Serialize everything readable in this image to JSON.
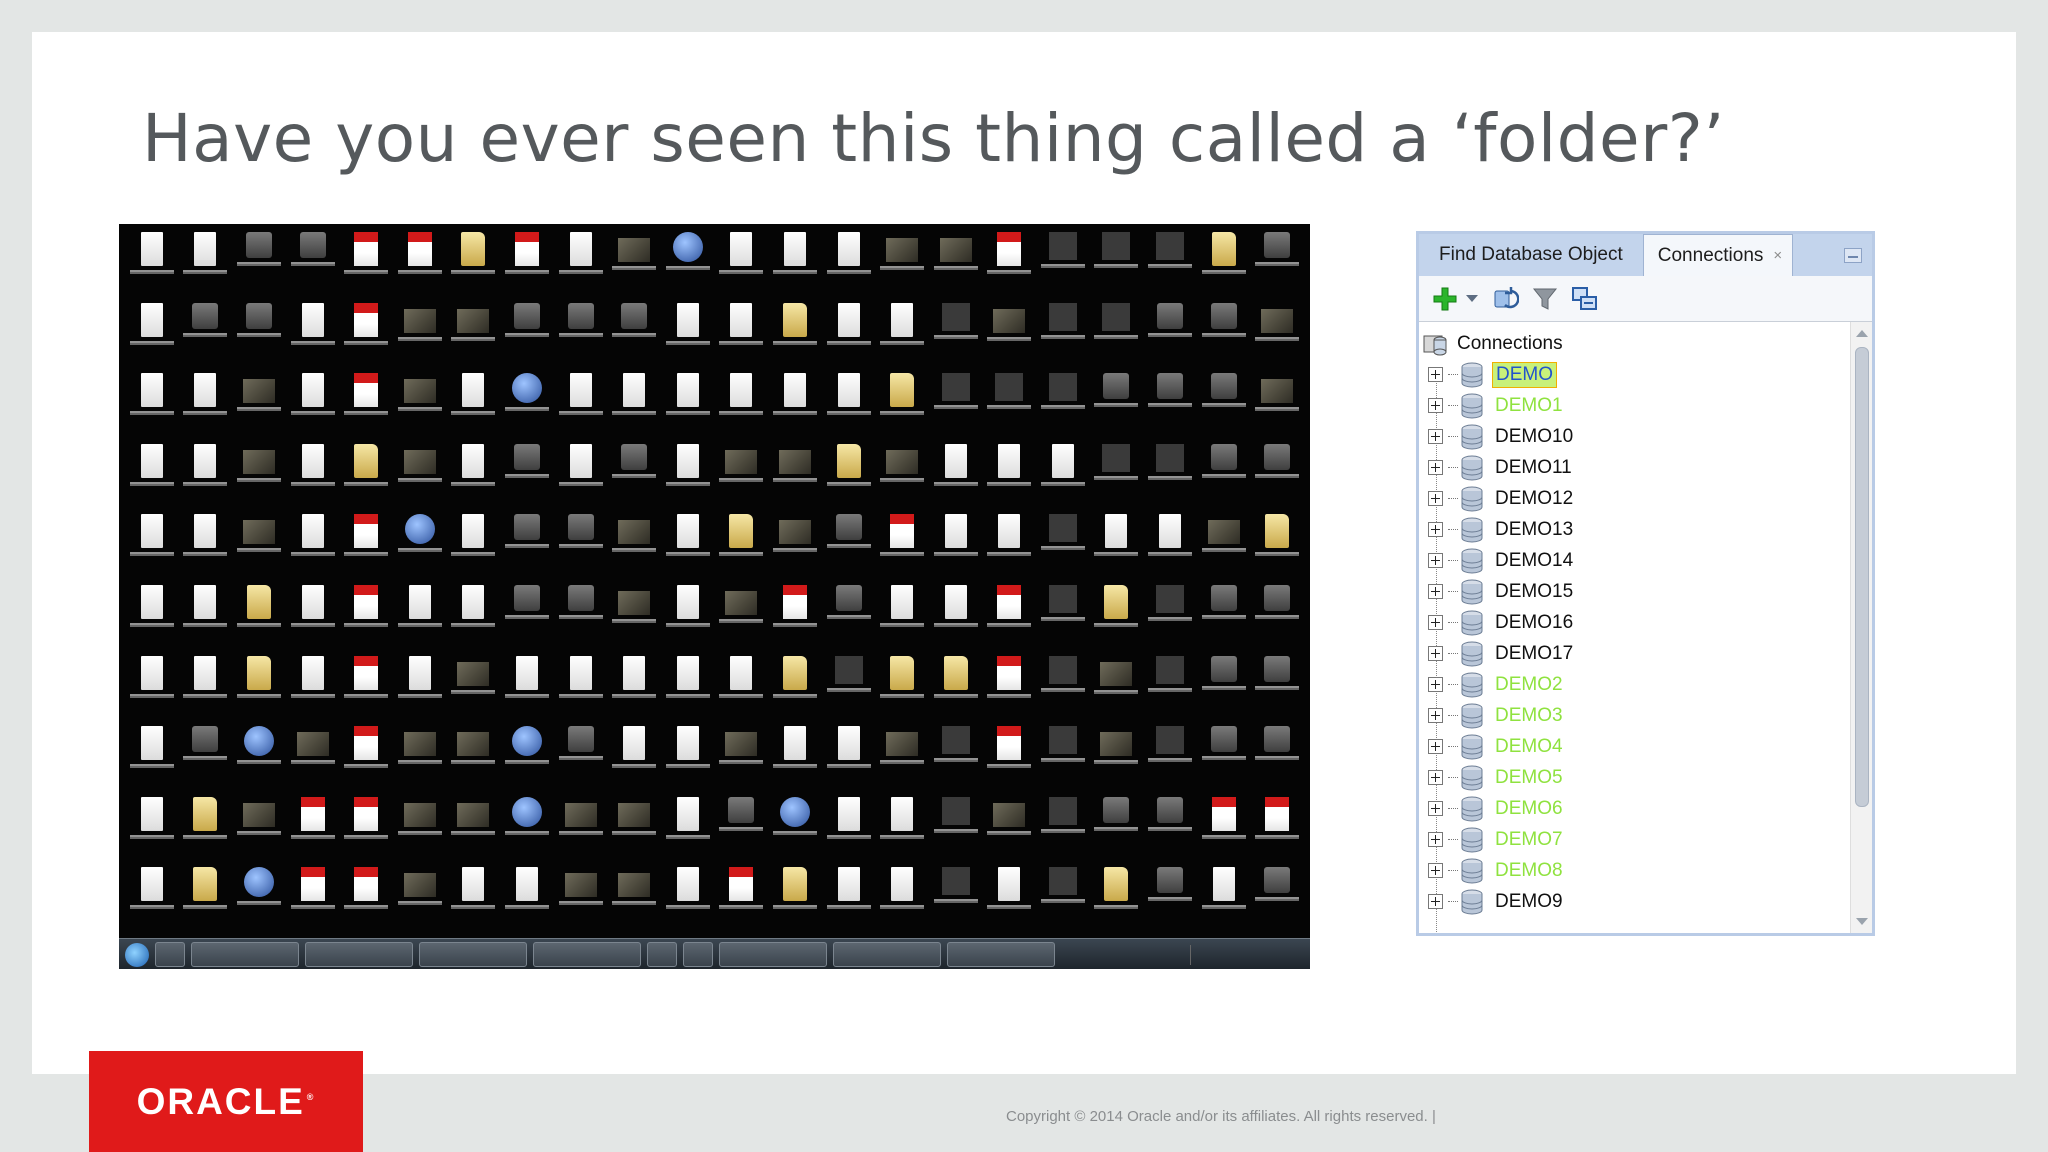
{
  "slide": {
    "title": "Have you ever seen this thing called a ‘folder?’"
  },
  "desktop_screenshot": {
    "icon_types": [
      "doc",
      "doc",
      "gray",
      "gray",
      "pdf",
      "pdf",
      "fold",
      "pdf",
      "doc",
      "img",
      "app",
      "doc",
      "doc",
      "doc",
      "img",
      "img",
      "pdf",
      "dark",
      "dark",
      "dark",
      "fold",
      "gray",
      "doc",
      "gray",
      "gray",
      "doc",
      "pdf",
      "img",
      "img",
      "gray",
      "gray",
      "gray",
      "doc",
      "doc",
      "fold",
      "doc",
      "doc",
      "dark",
      "img",
      "dark",
      "dark",
      "gray",
      "gray",
      "img",
      "doc",
      "doc",
      "img",
      "doc",
      "pdf",
      "img",
      "doc",
      "app",
      "doc",
      "doc",
      "doc",
      "doc",
      "doc",
      "doc",
      "fold",
      "dark",
      "dark",
      "dark",
      "gray",
      "gray",
      "gray",
      "img",
      "doc",
      "doc",
      "img",
      "doc",
      "fold",
      "img",
      "doc",
      "gray",
      "doc",
      "gray",
      "doc",
      "img",
      "img",
      "fold",
      "img",
      "doc",
      "doc",
      "doc",
      "dark",
      "dark",
      "gray",
      "gray",
      "doc",
      "doc",
      "img",
      "doc",
      "pdf",
      "app",
      "doc",
      "gray",
      "gray",
      "img",
      "doc",
      "fold",
      "img",
      "gray",
      "pdf",
      "doc",
      "doc",
      "dark",
      "doc",
      "doc",
      "img",
      "fold",
      "doc",
      "doc",
      "fold",
      "doc",
      "pdf",
      "doc",
      "doc",
      "gray",
      "gray",
      "img",
      "doc",
      "img",
      "pdf",
      "gray",
      "doc",
      "doc",
      "pdf",
      "dark",
      "fold",
      "dark",
      "gray",
      "gray",
      "doc",
      "doc",
      "fold",
      "doc",
      "pdf",
      "doc",
      "img",
      "doc",
      "doc",
      "doc",
      "doc",
      "doc",
      "fold",
      "dark",
      "fold",
      "fold",
      "pdf",
      "dark",
      "img",
      "dark",
      "gray",
      "gray",
      "doc",
      "gray",
      "app",
      "img",
      "pdf",
      "img",
      "img",
      "app",
      "gray",
      "doc",
      "doc",
      "img",
      "doc",
      "doc",
      "img",
      "dark",
      "pdf",
      "dark",
      "img",
      "dark",
      "gray",
      "gray",
      "doc",
      "fold",
      "img",
      "pdf",
      "pdf",
      "img",
      "img",
      "app",
      "img",
      "img",
      "doc",
      "gray",
      "app",
      "doc",
      "doc",
      "dark",
      "img",
      "dark",
      "gray",
      "gray",
      "pdf",
      "pdf",
      "doc",
      "fold",
      "app",
      "pdf",
      "pdf",
      "img",
      "doc",
      "doc",
      "img",
      "img",
      "doc",
      "pdf",
      "fold",
      "doc",
      "doc",
      "dark",
      "doc",
      "dark",
      "fold",
      "gray",
      "doc",
      "gray"
    ]
  },
  "panel": {
    "tabs": [
      {
        "label": "Find Database Object",
        "active": false
      },
      {
        "label": "Connections",
        "active": true,
        "close_icon": "×"
      }
    ],
    "toolbar_icons": [
      "add-connection-icon",
      "dropdown-arrow-icon",
      "refresh-icon",
      "filter-icon",
      "schema-browser-icon"
    ],
    "root_label": "Connections",
    "nodes": [
      {
        "label": "DEMO",
        "style": "selected"
      },
      {
        "label": "DEMO1",
        "style": "faded"
      },
      {
        "label": "DEMO10",
        "style": "normal"
      },
      {
        "label": "DEMO11",
        "style": "normal"
      },
      {
        "label": "DEMO12",
        "style": "normal"
      },
      {
        "label": "DEMO13",
        "style": "normal"
      },
      {
        "label": "DEMO14",
        "style": "normal"
      },
      {
        "label": "DEMO15",
        "style": "normal"
      },
      {
        "label": "DEMO16",
        "style": "normal"
      },
      {
        "label": "DEMO17",
        "style": "normal"
      },
      {
        "label": "DEMO2",
        "style": "faded"
      },
      {
        "label": "DEMO3",
        "style": "faded"
      },
      {
        "label": "DEMO4",
        "style": "faded"
      },
      {
        "label": "DEMO5",
        "style": "faded"
      },
      {
        "label": "DEMO6",
        "style": "faded"
      },
      {
        "label": "DEMO7",
        "style": "faded"
      },
      {
        "label": "DEMO8",
        "style": "faded"
      },
      {
        "label": "DEMO9",
        "style": "normal"
      }
    ]
  },
  "footer": {
    "logo_text": "ORACLE",
    "logo_reg": "®",
    "copyright": "Copyright © 2014 Oracle and/or its affiliates. All rights reserved.  |"
  },
  "colors": {
    "oracle_red": "#e01a1a",
    "selected_highlight": "#c8f17a",
    "faded_green": "#8fe23f",
    "panel_border": "#b9cbe6"
  }
}
